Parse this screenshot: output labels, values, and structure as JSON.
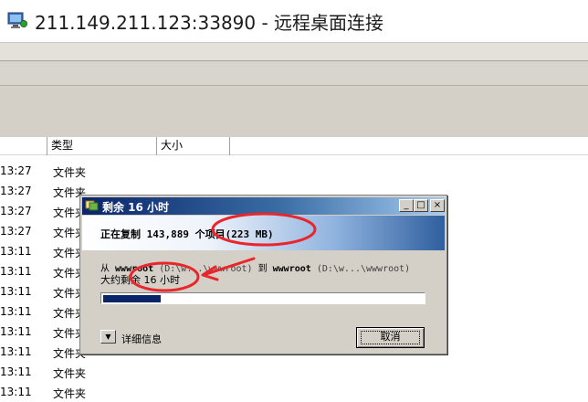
{
  "window": {
    "title": "211.149.211.123:33890 - 远程桌面连接"
  },
  "columns": [
    "类型",
    "大小"
  ],
  "files": [
    {
      "time": "13:27",
      "type": "文件夹"
    },
    {
      "time": "13:27",
      "type": "文件夹"
    },
    {
      "time": "13:27",
      "type": "文件夹"
    },
    {
      "time": "13:27",
      "type": "文件夹"
    },
    {
      "time": "13:11",
      "type": "文件夹"
    },
    {
      "time": "13:11",
      "type": "文件夹"
    },
    {
      "time": "13:11",
      "type": "文件夹"
    },
    {
      "time": "13:11",
      "type": "文件夹"
    },
    {
      "time": "13:11",
      "type": "文件夹"
    },
    {
      "time": "13:11",
      "type": "文件夹"
    },
    {
      "time": "13:11",
      "type": "文件夹"
    },
    {
      "time": "13:11",
      "type": "文件夹"
    }
  ],
  "dialog": {
    "title": "剩余 16 小时",
    "status": "正在复制 143,889 个项目(223 MB)",
    "from_label": "从",
    "from_name": "wwwroot",
    "from_path": "(D:\\w...\\wwwroot)",
    "to_label": "到",
    "to_name": "wwwroot",
    "to_path": "(D:\\w...\\wwwroot)",
    "remaining": "大约剩余 16 小时",
    "progress": 0.18,
    "details_label": "详细信息",
    "cancel_label": "取消",
    "min_glyph": "_",
    "max_glyph": "□",
    "close_glyph": "×"
  },
  "colors": {
    "annotation": "#e8262b",
    "progress_fill": "#0a246a",
    "title_gradient_start": "#0a246a"
  }
}
